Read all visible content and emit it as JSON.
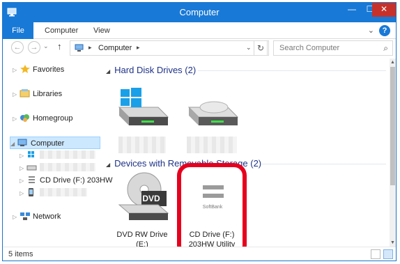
{
  "window": {
    "title": "Computer",
    "controls": {
      "minimize": "—",
      "maximize": "☐",
      "close": "✕"
    }
  },
  "ribbon": {
    "file_tab": "File",
    "tabs": [
      "Computer",
      "View"
    ],
    "expand_icon": "chevron-down-icon",
    "help_icon": "help-icon",
    "help_glyph": "?"
  },
  "navigation": {
    "back_icon": "back-arrow-icon",
    "forward_icon": "forward-arrow-icon",
    "up_icon": "up-arrow-icon",
    "address_path": "Computer",
    "search_placeholder": "Search Computer"
  },
  "sidebar": {
    "favorites": "Favorites",
    "libraries": "Libraries",
    "homegroup": "Homegroup",
    "computer": "Computer",
    "cd_drive": "CD Drive (F:) 203HW",
    "network": "Network"
  },
  "groups": {
    "hard_disk": "Hard Disk Drives (2)",
    "removable": "Devices with Removable Storage (2)"
  },
  "drives": {
    "dvd_label_line1": "DVD RW Drive",
    "dvd_label_line2": "(E:)",
    "dvd_badge": "DVD",
    "cd_label_line1": "CD Drive (F:)",
    "cd_label_line2": "203HW Utility",
    "cd_brand": "SoftBank"
  },
  "status": {
    "items": "5 items"
  },
  "colors": {
    "accent": "#1979d6",
    "close": "#c7312b",
    "highlight_ring": "#e6001e",
    "selection": "#cce8ff"
  }
}
